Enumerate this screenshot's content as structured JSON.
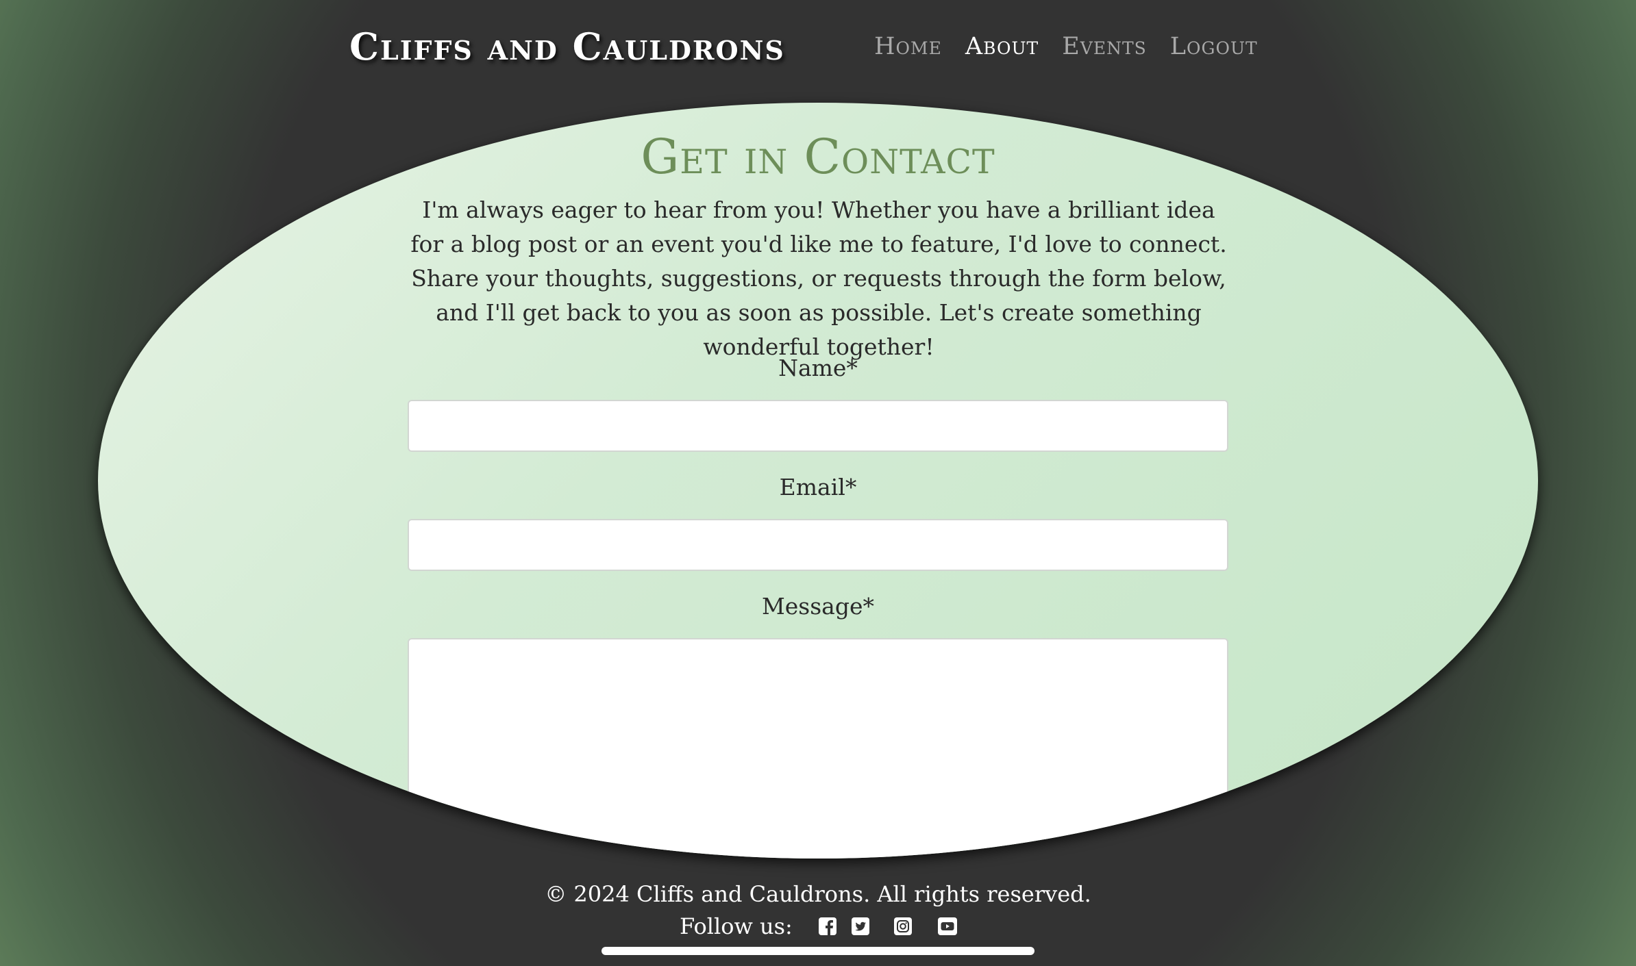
{
  "header": {
    "site_title": "Cliffs and Cauldrons",
    "nav": [
      {
        "label": "Home",
        "active": false
      },
      {
        "label": "About",
        "active": true
      },
      {
        "label": "Events",
        "active": false
      },
      {
        "label": "Logout",
        "active": false
      }
    ]
  },
  "main": {
    "title": "Get in Contact",
    "intro": "I'm always eager to hear from you! Whether you have a brilliant idea for a blog post or an event you'd like me to feature, I'd love to connect. Share your thoughts, suggestions, or requests through the form below, and I'll get back to you as soon as possible. Let's create something wonderful together!",
    "form": {
      "name_label": "Name*",
      "name_value": "",
      "email_label": "Email*",
      "email_value": "",
      "message_label": "Message*",
      "message_value": ""
    }
  },
  "footer": {
    "copyright": "© 2024 Cliffs and Cauldrons. All rights reserved.",
    "follow_label": "Follow us:",
    "social_icons": [
      "facebook-icon",
      "twitter-icon",
      "instagram-icon",
      "youtube-icon"
    ]
  },
  "colors": {
    "title_green": "#6d8e59",
    "panel_light": "#e6f3e4",
    "panel_mid": "#c6e6c8",
    "dark_bg": "#333333",
    "edge_green": "#6a8d62"
  }
}
